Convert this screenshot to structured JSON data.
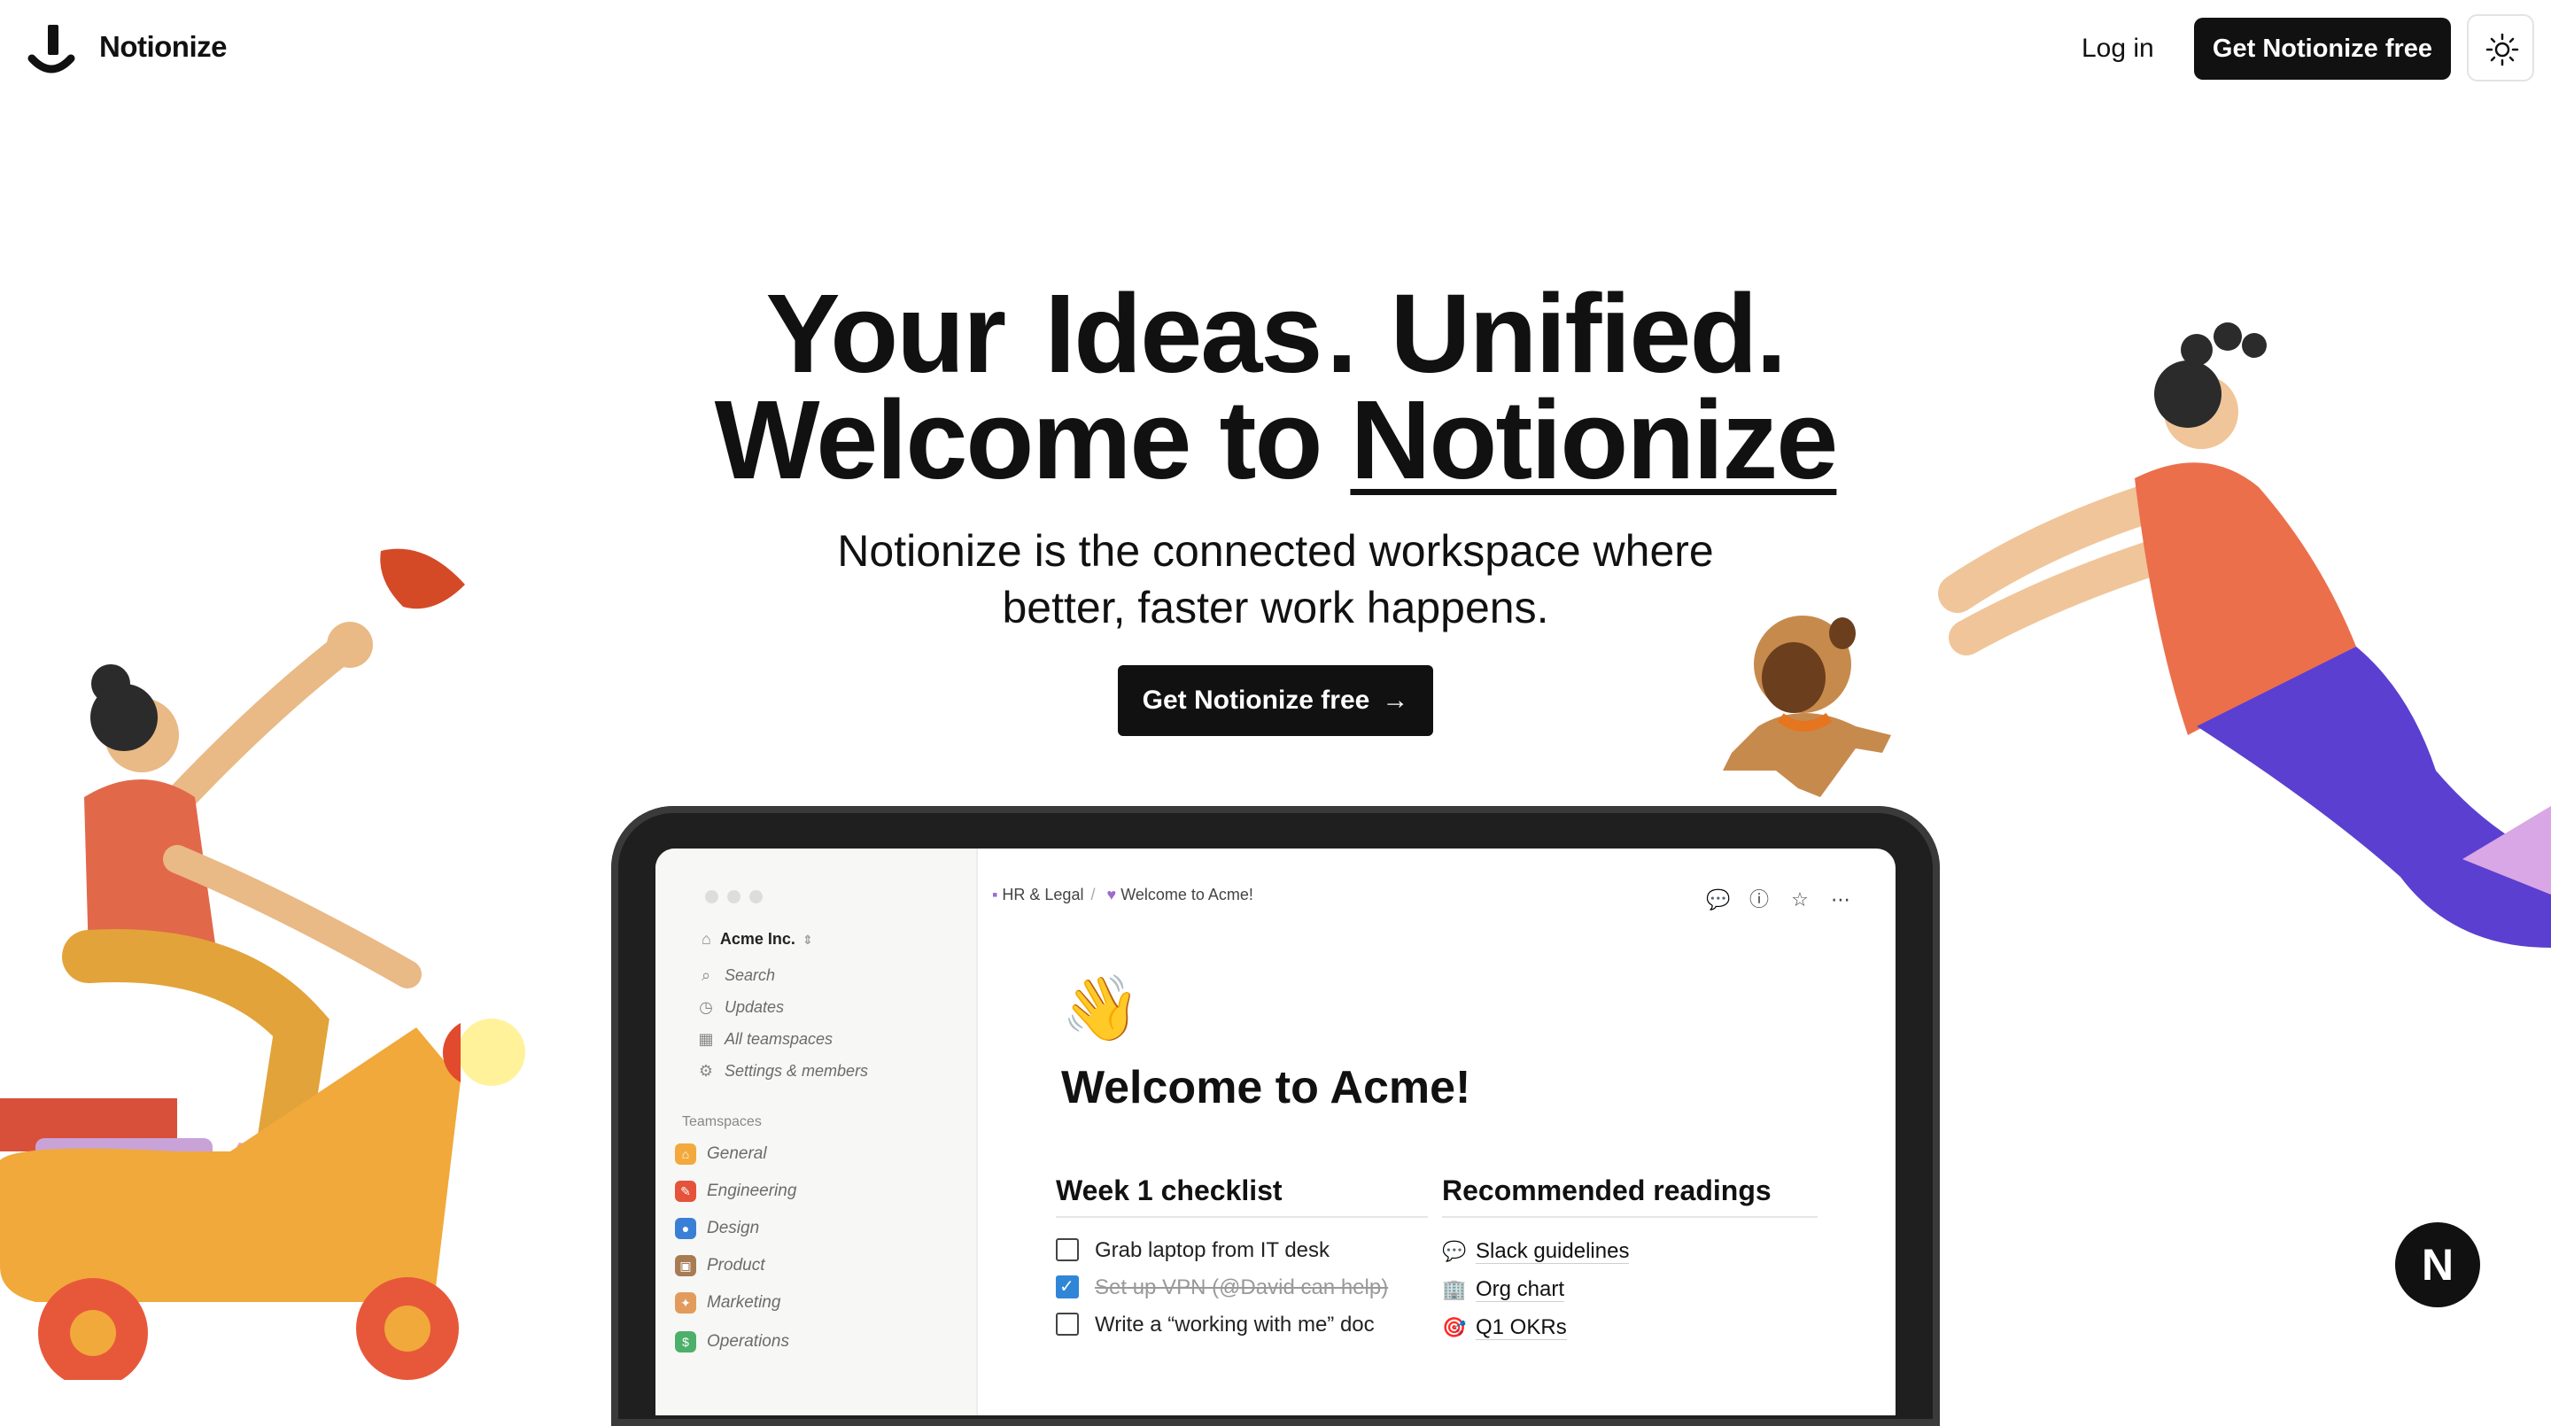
{
  "nav": {
    "brand": "Notionize",
    "login": "Log in",
    "cta": "Get Notionize free",
    "theme_icon": "sun-icon"
  },
  "hero": {
    "line1_a": "Your",
    "line1_b": "Ideas",
    "line1_c": ".",
    "line1_d": "Unified.",
    "line2_a": "Welcome to",
    "line2_b": "Notionize",
    "subtitle_1": "Notionize is the connected workspace where",
    "subtitle_2": "better, faster work happens.",
    "cta": "Get Notionize free",
    "cta_icon": "arrow-right-icon"
  },
  "app": {
    "workspace": "Acme Inc.",
    "sidebar": [
      {
        "icon": "search-icon",
        "label": "Search"
      },
      {
        "icon": "clock-icon",
        "label": "Updates"
      },
      {
        "icon": "grid-icon",
        "label": "All teamspaces"
      },
      {
        "icon": "gear-icon",
        "label": "Settings & members"
      }
    ],
    "teamspaces_heading": "Teamspaces",
    "teamspaces": [
      {
        "label": "General",
        "color": "#f3a93c"
      },
      {
        "label": "Engineering",
        "color": "#e4533a"
      },
      {
        "label": "Design",
        "color": "#3a7fd6"
      },
      {
        "label": "Product",
        "color": "#a77b53"
      },
      {
        "label": "Marketing",
        "color": "#e29b5c"
      },
      {
        "label": "Operations",
        "color": "#4caf6a"
      }
    ],
    "breadcrumb_1": "HR & Legal",
    "breadcrumb_2": "Welcome to Acme!",
    "page_title": "Welcome to Acme!",
    "checklist_heading": "Week 1 checklist",
    "checklist": [
      {
        "text": "Grab laptop from IT desk",
        "done": false
      },
      {
        "text": "Set up VPN (@David can help)",
        "done": true
      },
      {
        "text": "Write a “working with me” doc",
        "done": false
      }
    ],
    "readings_heading": "Recommended readings",
    "readings": [
      {
        "icon": "speech-bubble-icon",
        "text": "Slack guidelines"
      },
      {
        "icon": "building-icon",
        "text": "Org chart"
      },
      {
        "icon": "target-icon",
        "text": "Q1 OKRs"
      }
    ]
  },
  "badge": {
    "letter": "N"
  }
}
